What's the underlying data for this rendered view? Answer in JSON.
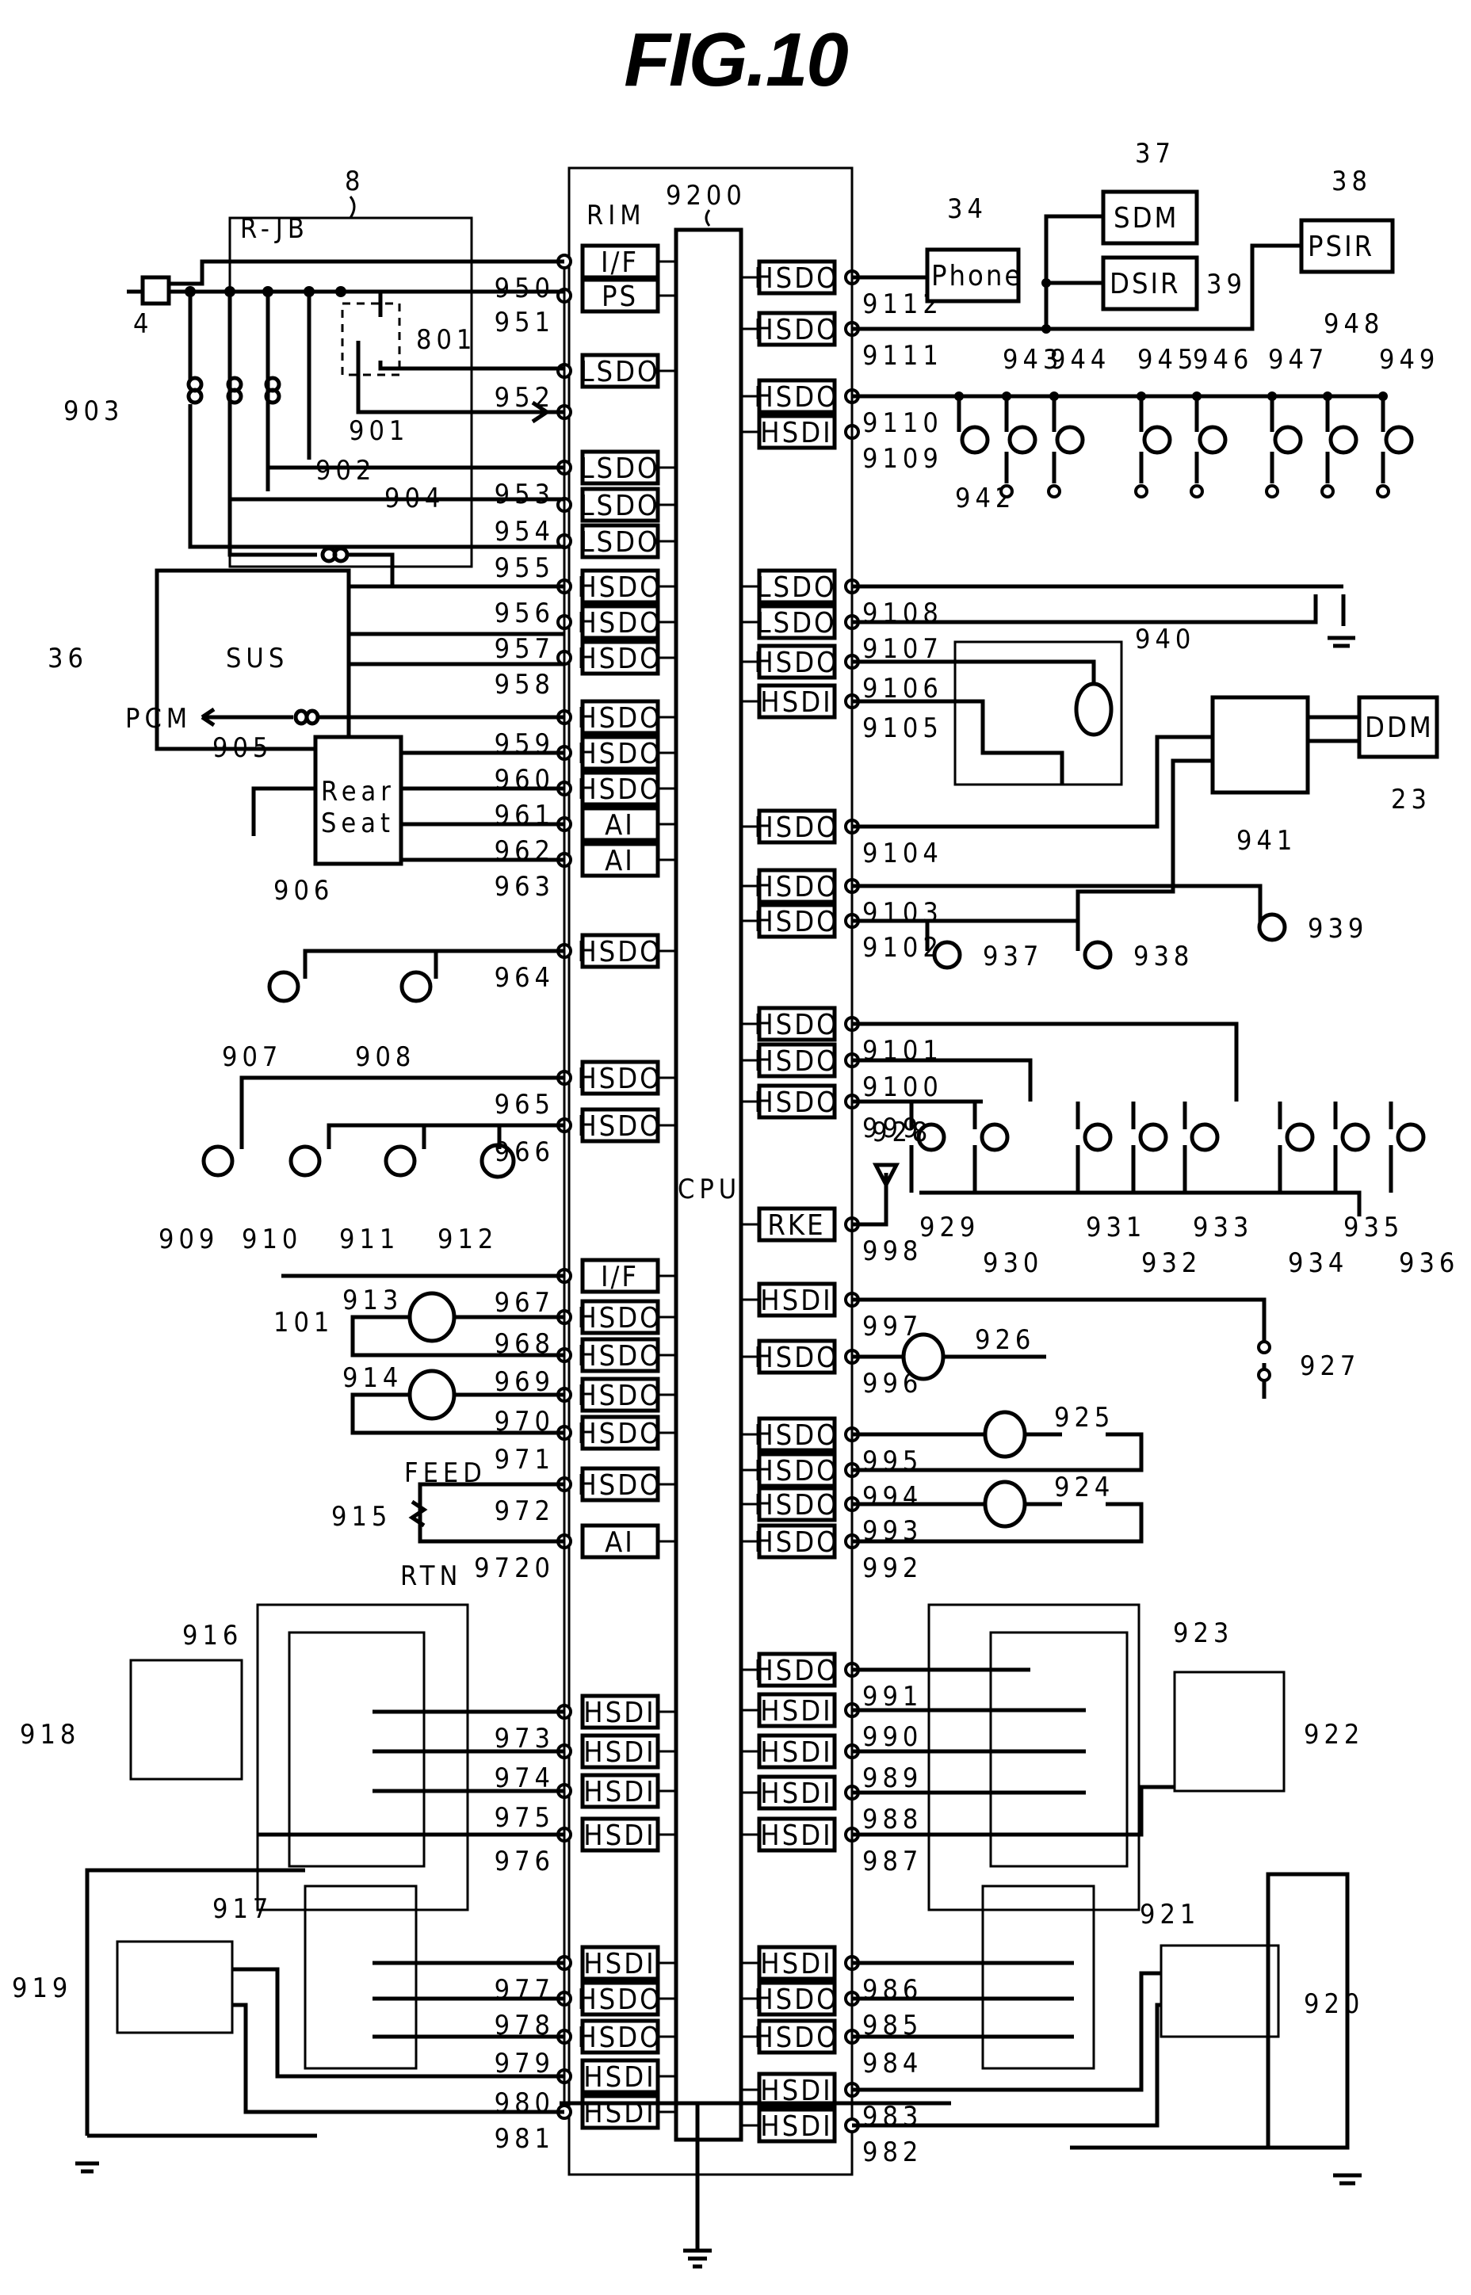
{
  "figure": {
    "title": "FIG.10"
  },
  "modules": {
    "rim": {
      "label": "RIM",
      "ref": "9200"
    },
    "cpu": {
      "label": "CPU"
    },
    "rjb": {
      "label": "R-JB",
      "ref": "8"
    },
    "sus": {
      "label": "SUS",
      "ref": "36"
    },
    "phone": {
      "label": "Phone",
      "ref": "34"
    },
    "sdm": {
      "label": "SDM",
      "ref": "37"
    },
    "psir": {
      "label": "PSIR",
      "ref": "38"
    },
    "dsir": {
      "label": "DSIR",
      "ref": "39"
    },
    "ddm": {
      "label": "DDM",
      "ref": "23"
    },
    "block941": {
      "label": "",
      "ref": "941"
    },
    "rear_seat": {
      "label_line1": "Rear",
      "label_line2": "Seat",
      "ref": "906"
    },
    "pcm": {
      "label": "PCM"
    },
    "connector4": {
      "ref": "4"
    },
    "relay801": {
      "ref": "801"
    },
    "feed": {
      "label": "FEED"
    },
    "rtn": {
      "label": "RTN"
    }
  },
  "left_channels": [
    {
      "type": "I/F",
      "pin": "950"
    },
    {
      "type": "PS",
      "pin": "951"
    },
    {
      "type": "LSDO",
      "pin": "952"
    },
    {
      "type": "",
      "pin": ""
    },
    {
      "type": "LSDO",
      "pin": "953"
    },
    {
      "type": "LSDO",
      "pin": "954"
    },
    {
      "type": "LSDO",
      "pin": "955"
    },
    {
      "type": "HSDO",
      "pin": "956"
    },
    {
      "type": "HSDO",
      "pin": "957"
    },
    {
      "type": "HSDO",
      "pin": "958"
    },
    {
      "type": "HSDO",
      "pin": "959"
    },
    {
      "type": "HSDO",
      "pin": "960"
    },
    {
      "type": "HSDO",
      "pin": "961"
    },
    {
      "type": "AI",
      "pin": "962"
    },
    {
      "type": "AI",
      "pin": "963"
    },
    {
      "type": "HSDO",
      "pin": "964"
    },
    {
      "type": "HSDO",
      "pin": "965"
    },
    {
      "type": "HSDO",
      "pin": "966"
    },
    {
      "type": "I/F",
      "pin": "967"
    },
    {
      "type": "HSDO",
      "pin": "968"
    },
    {
      "type": "HSDO",
      "pin": "969"
    },
    {
      "type": "HSDO",
      "pin": "970"
    },
    {
      "type": "HSDO",
      "pin": "971"
    },
    {
      "type": "HSDO",
      "pin": "972"
    },
    {
      "type": "AI",
      "pin": "9720"
    },
    {
      "type": "HSDI",
      "pin": "973"
    },
    {
      "type": "HSDI",
      "pin": "974"
    },
    {
      "type": "HSDI",
      "pin": "975"
    },
    {
      "type": "HSDI",
      "pin": "976"
    },
    {
      "type": "HSDI",
      "pin": "977"
    },
    {
      "type": "HSDO",
      "pin": "978"
    },
    {
      "type": "HSDO",
      "pin": "979"
    },
    {
      "type": "HSDI",
      "pin": "980"
    },
    {
      "type": "HSDI",
      "pin": "981"
    }
  ],
  "right_channels": [
    {
      "type": "HSDO",
      "pin": "9112"
    },
    {
      "type": "HSDO",
      "pin": "9111"
    },
    {
      "type": "HSDO",
      "pin": "9110"
    },
    {
      "type": "HSDI",
      "pin": "9109"
    },
    {
      "type": "LSDO",
      "pin": "9108"
    },
    {
      "type": "LSDO",
      "pin": "9107"
    },
    {
      "type": "HSDO",
      "pin": "9106"
    },
    {
      "type": "HSDI",
      "pin": "9105"
    },
    {
      "type": "HSDO",
      "pin": "9104"
    },
    {
      "type": "HSDO",
      "pin": "9103"
    },
    {
      "type": "HSDO",
      "pin": "9102"
    },
    {
      "type": "HSDO",
      "pin": "9101"
    },
    {
      "type": "HSDO",
      "pin": "9100"
    },
    {
      "type": "HSDO",
      "pin": "999"
    },
    {
      "type": "RKE",
      "pin": "998"
    },
    {
      "type": "HSDI",
      "pin": "997"
    },
    {
      "type": "HSDO",
      "pin": "996"
    },
    {
      "type": "HSDO",
      "pin": "995"
    },
    {
      "type": "HSDO",
      "pin": "994"
    },
    {
      "type": "HSDO",
      "pin": "993"
    },
    {
      "type": "HSDO",
      "pin": "992"
    },
    {
      "type": "HSDO",
      "pin": "991"
    },
    {
      "type": "HSDI",
      "pin": "990"
    },
    {
      "type": "HSDI",
      "pin": "989"
    },
    {
      "type": "HSDI",
      "pin": "988"
    },
    {
      "type": "HSDI",
      "pin": "987"
    },
    {
      "type": "HSDI",
      "pin": "986"
    },
    {
      "type": "HSDO",
      "pin": "985"
    },
    {
      "type": "HSDO",
      "pin": "984"
    },
    {
      "type": "HSDI",
      "pin": "983"
    },
    {
      "type": "HSDI",
      "pin": "982"
    }
  ],
  "components": {
    "fuses": [
      "901",
      "902",
      "903",
      "904",
      "905"
    ],
    "lamps_left": [
      "907",
      "908",
      "909",
      "910",
      "911"
    ],
    "led_912": "912",
    "motors_left": [
      "913",
      "914"
    ],
    "potentiometer": "915",
    "switch_assemblies_left": [
      "916",
      "917",
      "918",
      "919"
    ],
    "switch_assemblies_right": [
      "920",
      "921",
      "922",
      "923"
    ],
    "motors_right": [
      "924",
      "925",
      "926"
    ],
    "switch_927": "927",
    "antenna_928": "928",
    "lamp_bank_lower": [
      "929",
      "930",
      "931",
      "932",
      "933",
      "934",
      "935",
      "936"
    ],
    "lamps_mid": [
      "937",
      "938",
      "939"
    ],
    "motor_assembly_940": "940",
    "lamp_bank_upper": [
      "942",
      "943",
      "944",
      "945",
      "946",
      "947",
      "948",
      "949"
    ],
    "bus_101": "101"
  }
}
